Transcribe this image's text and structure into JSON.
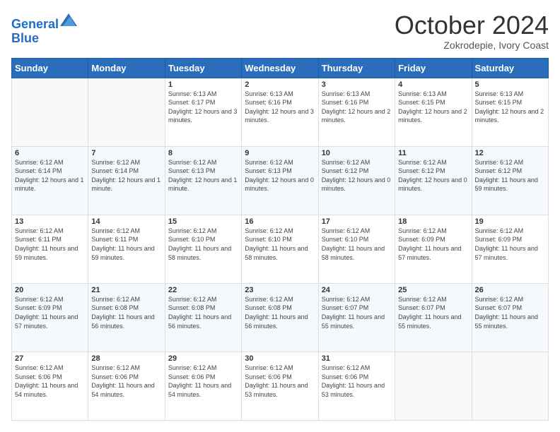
{
  "header": {
    "logo_line1": "General",
    "logo_line2": "Blue",
    "month": "October 2024",
    "location": "Zokrodepie, Ivory Coast"
  },
  "days_of_week": [
    "Sunday",
    "Monday",
    "Tuesday",
    "Wednesday",
    "Thursday",
    "Friday",
    "Saturday"
  ],
  "weeks": [
    [
      {
        "day": "",
        "info": ""
      },
      {
        "day": "",
        "info": ""
      },
      {
        "day": "1",
        "info": "Sunrise: 6:13 AM\nSunset: 6:17 PM\nDaylight: 12 hours and 3 minutes."
      },
      {
        "day": "2",
        "info": "Sunrise: 6:13 AM\nSunset: 6:16 PM\nDaylight: 12 hours and 3 minutes."
      },
      {
        "day": "3",
        "info": "Sunrise: 6:13 AM\nSunset: 6:16 PM\nDaylight: 12 hours and 2 minutes."
      },
      {
        "day": "4",
        "info": "Sunrise: 6:13 AM\nSunset: 6:15 PM\nDaylight: 12 hours and 2 minutes."
      },
      {
        "day": "5",
        "info": "Sunrise: 6:13 AM\nSunset: 6:15 PM\nDaylight: 12 hours and 2 minutes."
      }
    ],
    [
      {
        "day": "6",
        "info": "Sunrise: 6:12 AM\nSunset: 6:14 PM\nDaylight: 12 hours and 1 minute."
      },
      {
        "day": "7",
        "info": "Sunrise: 6:12 AM\nSunset: 6:14 PM\nDaylight: 12 hours and 1 minute."
      },
      {
        "day": "8",
        "info": "Sunrise: 6:12 AM\nSunset: 6:13 PM\nDaylight: 12 hours and 1 minute."
      },
      {
        "day": "9",
        "info": "Sunrise: 6:12 AM\nSunset: 6:13 PM\nDaylight: 12 hours and 0 minutes."
      },
      {
        "day": "10",
        "info": "Sunrise: 6:12 AM\nSunset: 6:12 PM\nDaylight: 12 hours and 0 minutes."
      },
      {
        "day": "11",
        "info": "Sunrise: 6:12 AM\nSunset: 6:12 PM\nDaylight: 12 hours and 0 minutes."
      },
      {
        "day": "12",
        "info": "Sunrise: 6:12 AM\nSunset: 6:12 PM\nDaylight: 11 hours and 59 minutes."
      }
    ],
    [
      {
        "day": "13",
        "info": "Sunrise: 6:12 AM\nSunset: 6:11 PM\nDaylight: 11 hours and 59 minutes."
      },
      {
        "day": "14",
        "info": "Sunrise: 6:12 AM\nSunset: 6:11 PM\nDaylight: 11 hours and 59 minutes."
      },
      {
        "day": "15",
        "info": "Sunrise: 6:12 AM\nSunset: 6:10 PM\nDaylight: 11 hours and 58 minutes."
      },
      {
        "day": "16",
        "info": "Sunrise: 6:12 AM\nSunset: 6:10 PM\nDaylight: 11 hours and 58 minutes."
      },
      {
        "day": "17",
        "info": "Sunrise: 6:12 AM\nSunset: 6:10 PM\nDaylight: 11 hours and 58 minutes."
      },
      {
        "day": "18",
        "info": "Sunrise: 6:12 AM\nSunset: 6:09 PM\nDaylight: 11 hours and 57 minutes."
      },
      {
        "day": "19",
        "info": "Sunrise: 6:12 AM\nSunset: 6:09 PM\nDaylight: 11 hours and 57 minutes."
      }
    ],
    [
      {
        "day": "20",
        "info": "Sunrise: 6:12 AM\nSunset: 6:09 PM\nDaylight: 11 hours and 57 minutes."
      },
      {
        "day": "21",
        "info": "Sunrise: 6:12 AM\nSunset: 6:08 PM\nDaylight: 11 hours and 56 minutes."
      },
      {
        "day": "22",
        "info": "Sunrise: 6:12 AM\nSunset: 6:08 PM\nDaylight: 11 hours and 56 minutes."
      },
      {
        "day": "23",
        "info": "Sunrise: 6:12 AM\nSunset: 6:08 PM\nDaylight: 11 hours and 56 minutes."
      },
      {
        "day": "24",
        "info": "Sunrise: 6:12 AM\nSunset: 6:07 PM\nDaylight: 11 hours and 55 minutes."
      },
      {
        "day": "25",
        "info": "Sunrise: 6:12 AM\nSunset: 6:07 PM\nDaylight: 11 hours and 55 minutes."
      },
      {
        "day": "26",
        "info": "Sunrise: 6:12 AM\nSunset: 6:07 PM\nDaylight: 11 hours and 55 minutes."
      }
    ],
    [
      {
        "day": "27",
        "info": "Sunrise: 6:12 AM\nSunset: 6:06 PM\nDaylight: 11 hours and 54 minutes."
      },
      {
        "day": "28",
        "info": "Sunrise: 6:12 AM\nSunset: 6:06 PM\nDaylight: 11 hours and 54 minutes."
      },
      {
        "day": "29",
        "info": "Sunrise: 6:12 AM\nSunset: 6:06 PM\nDaylight: 11 hours and 54 minutes."
      },
      {
        "day": "30",
        "info": "Sunrise: 6:12 AM\nSunset: 6:06 PM\nDaylight: 11 hours and 53 minutes."
      },
      {
        "day": "31",
        "info": "Sunrise: 6:12 AM\nSunset: 6:06 PM\nDaylight: 11 hours and 53 minutes."
      },
      {
        "day": "",
        "info": ""
      },
      {
        "day": "",
        "info": ""
      }
    ]
  ]
}
